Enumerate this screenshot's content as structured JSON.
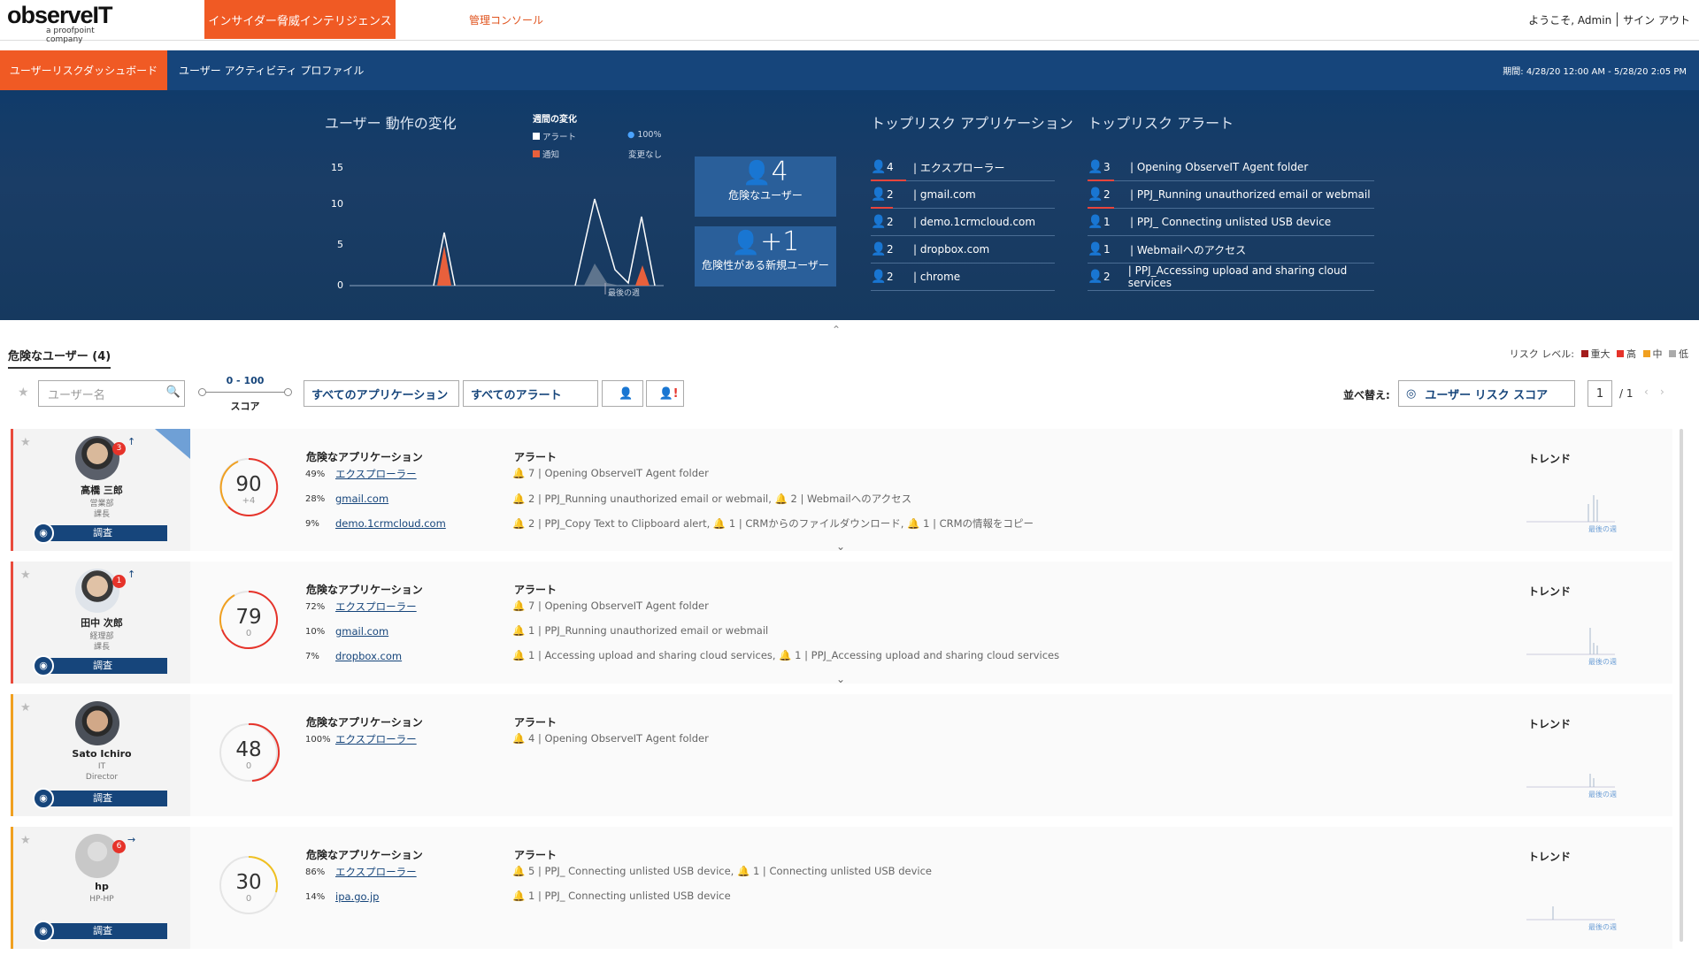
{
  "header": {
    "logo": "observeIT",
    "logo_sub": "a proofpoint company",
    "tab_main": "インサイダー脅威インテリジェンス",
    "tab_admin": "管理コンソール",
    "welcome": "ようこそ, Admin",
    "signout": "サイン アウト"
  },
  "nav": {
    "dashboard": "ユーザーリスクダッシュボード",
    "profile": "ユーザー アクティビティ プロファイル",
    "period": "期間: 4/28/20 12:00 AM - 5/28/20 2:05 PM"
  },
  "dash": {
    "change_title": "ユーザー 動作の変化",
    "weekly_title": "週間の変化",
    "leg_alert": "アラート",
    "leg_pct": "100%",
    "leg_notice": "通知",
    "leg_nochange": "変更なし",
    "y_ticks": [
      "15",
      "10",
      "5",
      "0"
    ],
    "x_label": "最後の週",
    "kpi1_num": "4",
    "kpi1_label": "危険なユーザー",
    "kpi2_num": "+1",
    "kpi2_label": "危険性がある新規ユーザー",
    "apps_title": "トップリスク アプリケーション",
    "alerts_title": "トップリスク アラート",
    "top_apps": [
      {
        "count": "4",
        "name": "| エクスプローラー"
      },
      {
        "count": "2",
        "name": "| gmail.com"
      },
      {
        "count": "2",
        "name": "| demo.1crmcloud.com"
      },
      {
        "count": "2",
        "name": "| dropbox.com"
      },
      {
        "count": "2",
        "name": "| chrome"
      }
    ],
    "top_alerts": [
      {
        "count": "3",
        "name": "| Opening ObserveIT Agent folder"
      },
      {
        "count": "2",
        "name": "| PPJ_Running unauthorized email or webmail"
      },
      {
        "count": "1",
        "name": "| PPJ_ Connecting unlisted USB device"
      },
      {
        "count": "1",
        "name": "| Webmailへのアクセス"
      },
      {
        "count": "2",
        "name": "| PPJ_Accessing upload and sharing cloud services"
      }
    ]
  },
  "list": {
    "title": "危険なユーザー (4)",
    "risk_level": "リスク レベル:",
    "risk_critical": "重大",
    "risk_high": "高",
    "risk_mid": "中",
    "risk_low": "低",
    "search_placeholder": "ユーザー名",
    "score_range": "0 - 100",
    "score_label": "スコア",
    "all_apps": "すべてのアプリケーション",
    "all_alerts": "すべてのアラート",
    "sort_label": "並べ替え:",
    "sort_value": "ユーザー リスク スコア",
    "page": "1",
    "page_total": "/ 1",
    "risky_apps": "危険なアプリケーション",
    "alerts": "アラート",
    "trend": "トレンド",
    "investigate": "調査",
    "trend_x": "最後の週"
  },
  "users": [
    {
      "name": "高橋 三郎",
      "dept": "営業部",
      "title": "課長",
      "badge": "3",
      "score": "90",
      "delta": "+4",
      "apps": [
        {
          "pct": "49%",
          "name": "エクスプローラー"
        },
        {
          "pct": "28%",
          "name": "gmail.com"
        },
        {
          "pct": "9%",
          "name": "demo.1crmcloud.com"
        }
      ],
      "alerts": [
        "7  | Opening ObserveIT Agent folder",
        "2  | PPJ_Running unauthorized email or webmail, 🔔 2 | Webmailへのアクセス",
        "2  | PPJ_Copy Text to Clipboard alert, 🔔 1 | CRMからのファイルダウンロード, 🔔 1 | CRMの情報をコピー"
      ]
    },
    {
      "name": "田中 次郎",
      "dept": "経理部",
      "title": "課長",
      "badge": "1",
      "score": "79",
      "delta": "0",
      "apps": [
        {
          "pct": "72%",
          "name": "エクスプローラー"
        },
        {
          "pct": "10%",
          "name": "gmail.com"
        },
        {
          "pct": "7%",
          "name": "dropbox.com"
        }
      ],
      "alerts": [
        "7  | Opening ObserveIT Agent folder",
        "1  | PPJ_Running unauthorized email or webmail",
        "1  | Accessing upload and sharing cloud services, 🔔 1 | PPJ_Accessing upload and sharing cloud services"
      ]
    },
    {
      "name": "Sato Ichiro",
      "dept": "IT",
      "title": "Director",
      "badge": "",
      "score": "48",
      "delta": "0",
      "apps": [
        {
          "pct": "100%",
          "name": "エクスプローラー"
        }
      ],
      "alerts": [
        "4  | Opening ObserveIT Agent folder"
      ]
    },
    {
      "name": "hp",
      "dept": "HP-HP",
      "title": "",
      "badge": "6",
      "score": "30",
      "delta": "0",
      "apps": [
        {
          "pct": "86%",
          "name": "エクスプローラー"
        },
        {
          "pct": "14%",
          "name": "ipa.go.jp"
        }
      ],
      "alerts": [
        "5  | PPJ_ Connecting unlisted USB device, 🔔 1 | Connecting unlisted USB device",
        "1  | PPJ_ Connecting unlisted USB device"
      ]
    }
  ],
  "colors": {
    "orange": "#f05a24",
    "navy": "#16457b",
    "critical": "#a31c1c",
    "high": "#e6332a",
    "mid": "#f0a020",
    "low": "#aaaaaa"
  }
}
